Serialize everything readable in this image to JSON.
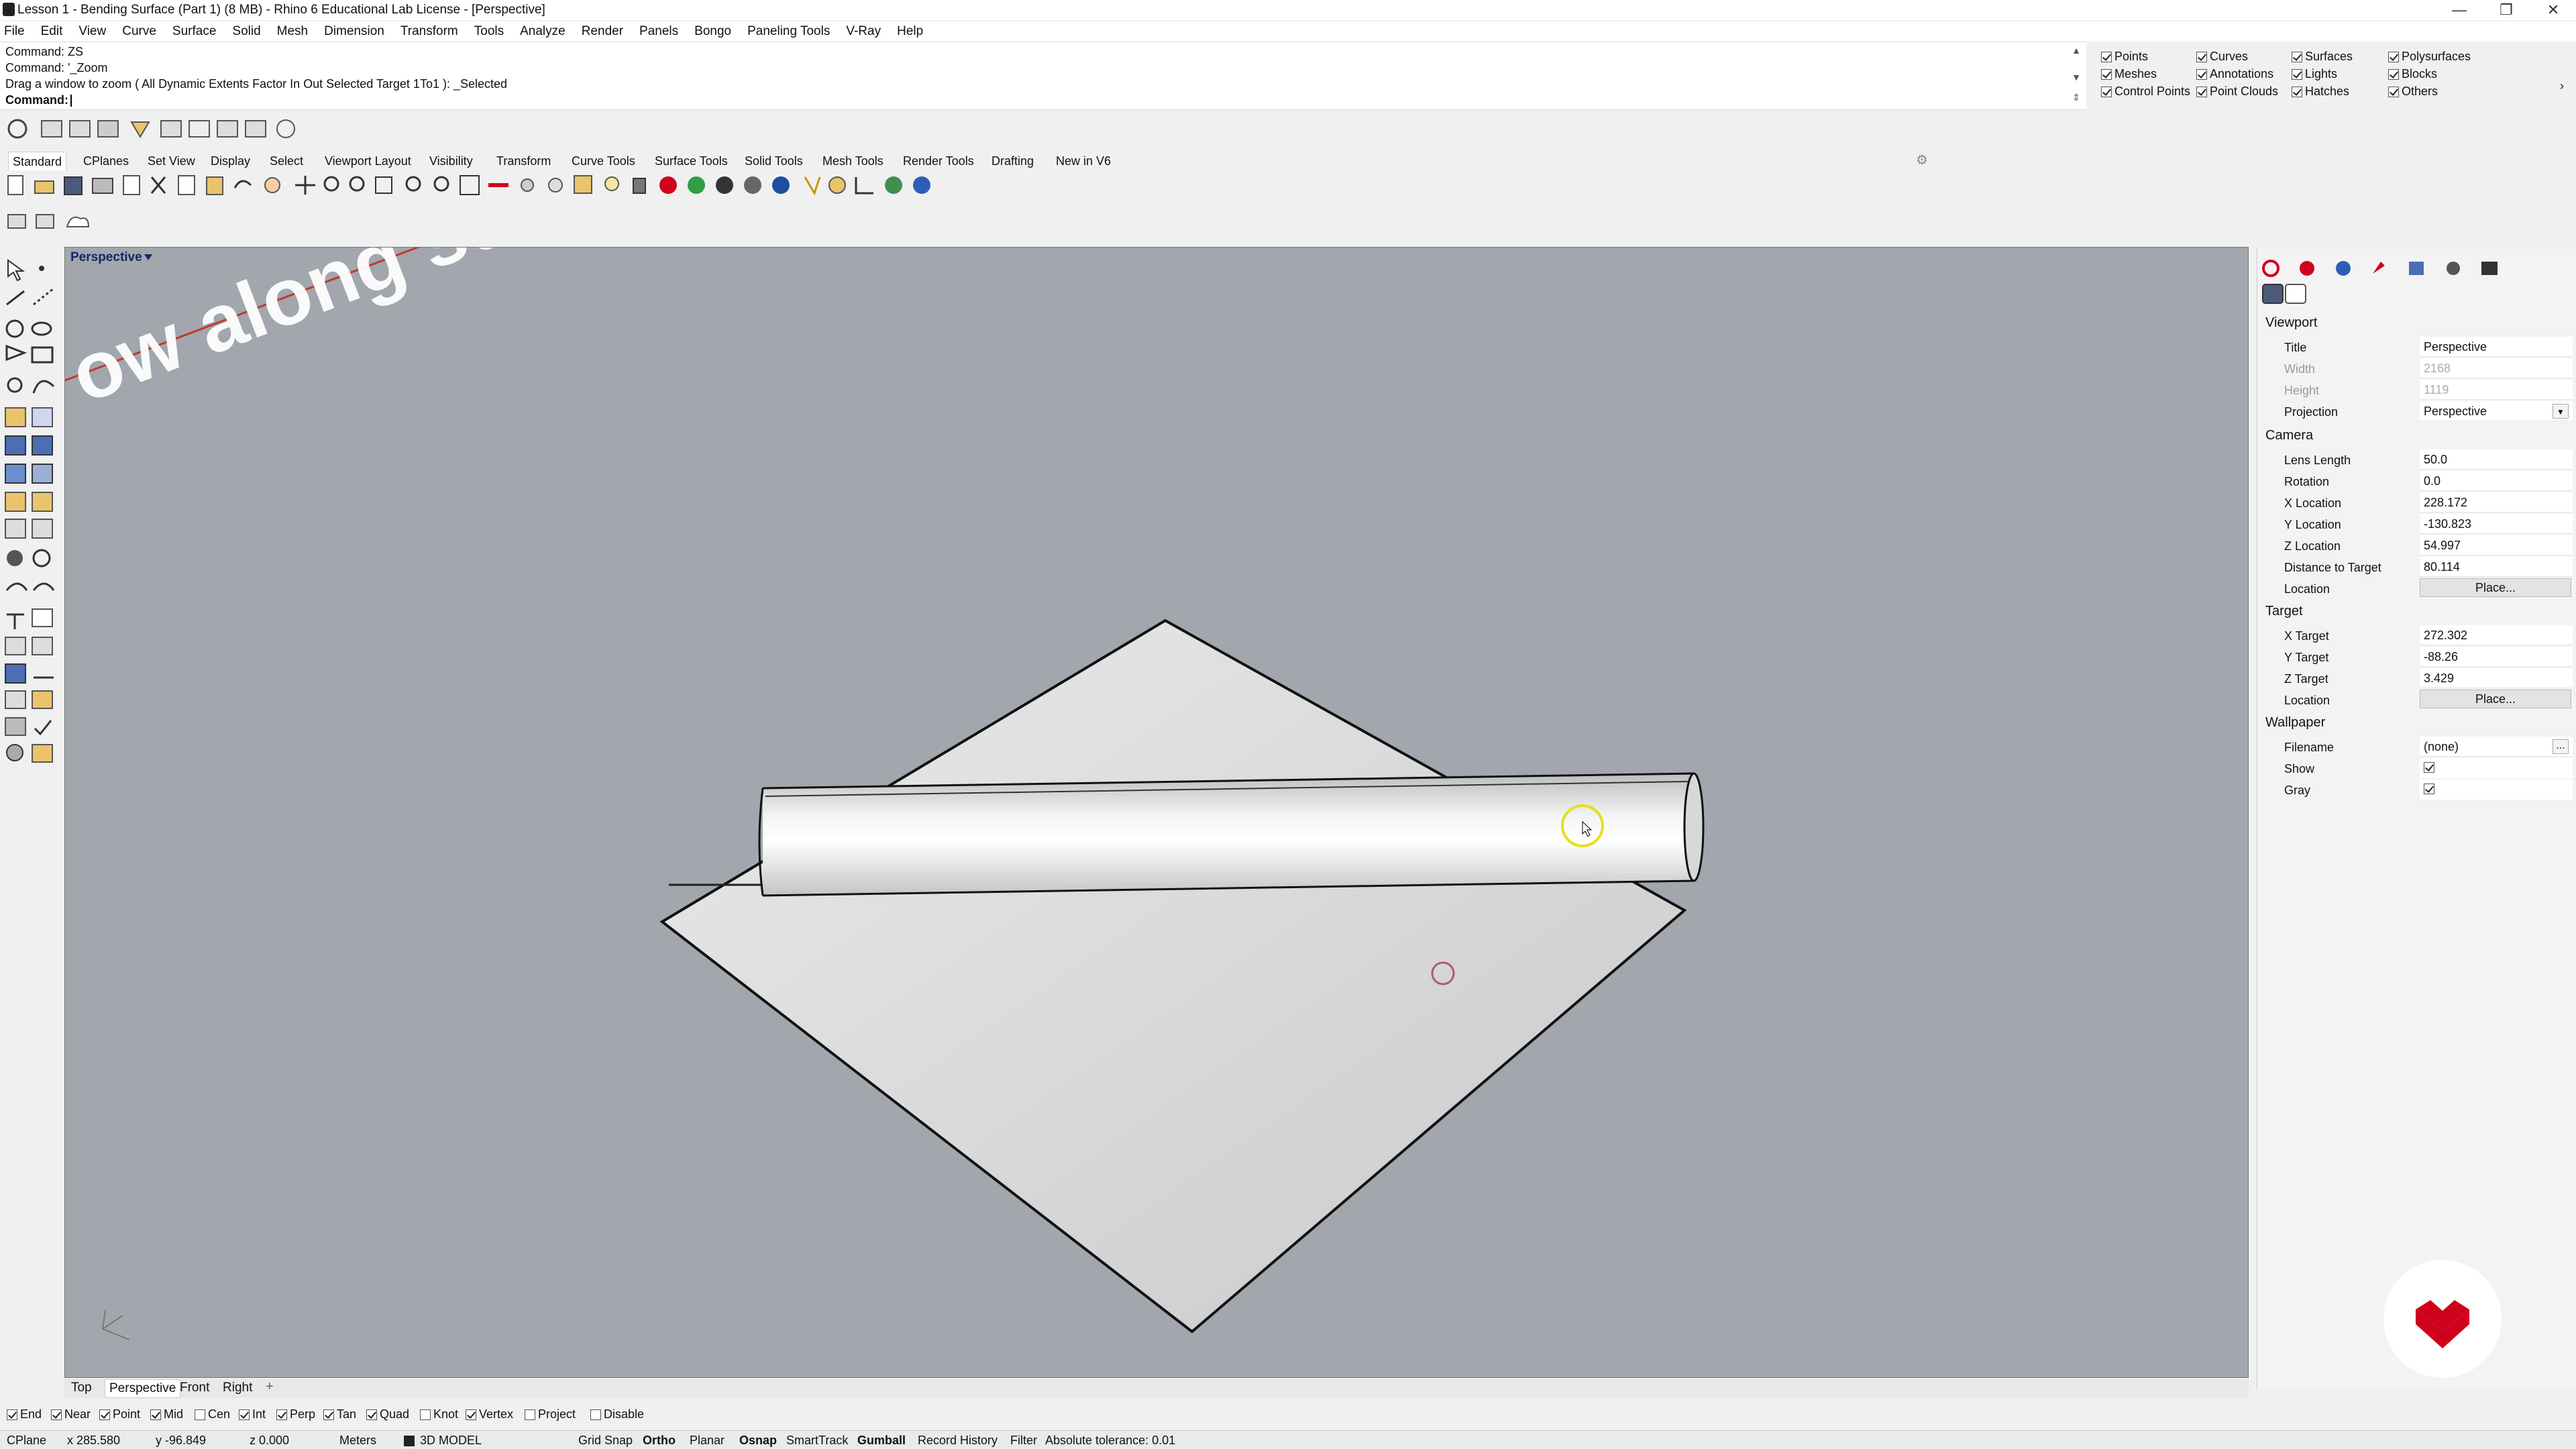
{
  "window": {
    "title": "Lesson 1 - Bending Surface (Part 1) (8 MB) - Rhino 6 Educational Lab License - [Perspective]",
    "minimize_glyph": "—",
    "restore_glyph": "❐",
    "close_glyph": "✕"
  },
  "menu": [
    "File",
    "Edit",
    "View",
    "Curve",
    "Surface",
    "Solid",
    "Mesh",
    "Dimension",
    "Transform",
    "Tools",
    "Analyze",
    "Render",
    "Panels",
    "Bongo",
    "Paneling Tools",
    "V-Ray",
    "Help"
  ],
  "command": {
    "history": [
      "Command: ZS",
      "Command: '_Zoom",
      "Drag a window to zoom ( All  Dynamic  Extents  Factor  In  Out  Selected  Target  1To1 ): _Selected"
    ],
    "prompt": "Command:",
    "value": ""
  },
  "filters": [
    {
      "label": "Points",
      "checked": true
    },
    {
      "label": "Curves",
      "checked": true
    },
    {
      "label": "Surfaces",
      "checked": true
    },
    {
      "label": "Polysurfaces",
      "checked": true
    },
    {
      "label": "Meshes",
      "checked": true
    },
    {
      "label": "Annotations",
      "checked": true
    },
    {
      "label": "Lights",
      "checked": true
    },
    {
      "label": "Blocks",
      "checked": true
    },
    {
      "label": "Control Points",
      "checked": true
    },
    {
      "label": "Point Clouds",
      "checked": true
    },
    {
      "label": "Hatches",
      "checked": true
    },
    {
      "label": "Others",
      "checked": true
    }
  ],
  "toolbar_tabs": [
    "Standard",
    "CPlanes",
    "Set View",
    "Display",
    "Select",
    "Viewport Layout",
    "Visibility",
    "Transform",
    "Curve Tools",
    "Surface Tools",
    "Solid Tools",
    "Mesh Tools",
    "Render Tools",
    "Drafting",
    "New in V6"
  ],
  "active_toolbar_tab": "Standard",
  "viewport": {
    "name": "Perspective",
    "watermark_text": "ow along surf"
  },
  "viewport_tabs": [
    "Top",
    "Perspective",
    "Front",
    "Right"
  ],
  "viewport_tab_add": "+",
  "osnaps": [
    {
      "label": "End",
      "checked": true
    },
    {
      "label": "Near",
      "checked": true
    },
    {
      "label": "Point",
      "checked": true
    },
    {
      "label": "Mid",
      "checked": true
    },
    {
      "label": "Cen",
      "checked": false
    },
    {
      "label": "Int",
      "checked": true
    },
    {
      "label": "Perp",
      "checked": true
    },
    {
      "label": "Tan",
      "checked": true
    },
    {
      "label": "Quad",
      "checked": true
    },
    {
      "label": "Knot",
      "checked": false
    },
    {
      "label": "Vertex",
      "checked": true
    },
    {
      "label": "Project",
      "checked": false
    },
    {
      "label": "Disable",
      "checked": false
    }
  ],
  "status": {
    "cplane": "CPlane",
    "x": "x 285.580",
    "y": "y -96.849",
    "z": "z 0.000",
    "units": "Meters",
    "layer": "3D MODEL",
    "grid_snap": "Grid Snap",
    "ortho": "Ortho",
    "planar": "Planar",
    "osnap": "Osnap",
    "smarttrack": "SmartTrack",
    "gumball": "Gumball",
    "record_history": "Record History",
    "filter": "Filter",
    "tolerance": "Absolute tolerance: 0.01"
  },
  "properties": {
    "viewport_header": "Viewport",
    "title_label": "Title",
    "title_value": "Perspective",
    "width_label": "Width",
    "width_value": "2168",
    "height_label": "Height",
    "height_value": "1119",
    "projection_label": "Projection",
    "projection_value": "Perspective",
    "camera_header": "Camera",
    "lens_label": "Lens Length",
    "lens_value": "50.0",
    "rotation_label": "Rotation",
    "rotation_value": "0.0",
    "xloc_label": "X Location",
    "xloc_value": "228.172",
    "yloc_label": "Y Location",
    "yloc_value": "-130.823",
    "zloc_label": "Z Location",
    "zloc_value": "54.997",
    "dist_label": "Distance to Target",
    "dist_value": "80.114",
    "location_label": "Location",
    "place_button": "Place...",
    "target_header": "Target",
    "xt_label": "X Target",
    "xt_value": "272.302",
    "yt_label": "Y Target",
    "yt_value": "-88.26",
    "zt_label": "Z Target",
    "zt_value": "3.429",
    "tloc_label": "Location",
    "tplace_button": "Place...",
    "wallpaper_header": "Wallpaper",
    "filename_label": "Filename",
    "filename_value": "(none)",
    "browse_button": "...",
    "show_label": "Show",
    "gray_label": "Gray"
  },
  "colors": {
    "viewport_bg": "#a2a6ad",
    "brand_logo": "#d0021b",
    "viewport_label": "#0d2a66"
  }
}
